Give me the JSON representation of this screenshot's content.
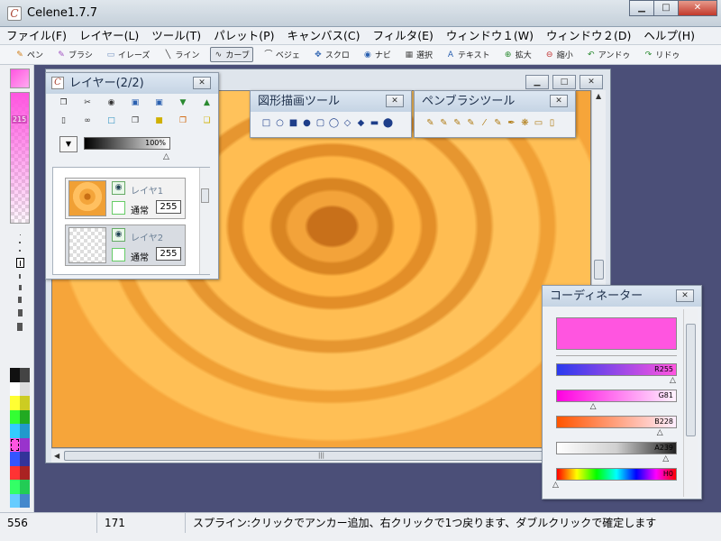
{
  "app": {
    "title": "Celene1.7.7",
    "icon": "C"
  },
  "window_buttons": {
    "minimize": "▁",
    "maximize": "□",
    "close": "✕"
  },
  "menu": [
    "ファイル(F)",
    "レイヤー(L)",
    "ツール(T)",
    "パレット(P)",
    "キャンバス(C)",
    "フィルタ(E)",
    "ウィンドウ１(W)",
    "ウィンドウ２(D)",
    "ヘルプ(H)"
  ],
  "toolbar": [
    {
      "label": "ペン",
      "icon": "pen-icon",
      "glyph": "✎",
      "color": "#d07a10",
      "active": false
    },
    {
      "label": "ブラシ",
      "icon": "brush-icon",
      "glyph": "✎",
      "color": "#a050c0",
      "active": false
    },
    {
      "label": "イレーズ",
      "icon": "eraser-icon",
      "glyph": "▭",
      "color": "#7090c0",
      "active": false
    },
    {
      "label": "ライン",
      "icon": "line-icon",
      "glyph": "╲",
      "color": "#333333",
      "active": false
    },
    {
      "label": "カーブ",
      "icon": "curve-icon",
      "glyph": "∿",
      "color": "#333333",
      "active": true
    },
    {
      "label": "ベジェ",
      "icon": "bezier-icon",
      "glyph": "⌒",
      "color": "#333333",
      "active": false
    },
    {
      "label": "スクロ",
      "icon": "scroll-icon",
      "glyph": "✥",
      "color": "#2a60b0",
      "active": false
    },
    {
      "label": "ナビ",
      "icon": "navi-icon",
      "glyph": "◉",
      "color": "#2a60b0",
      "active": false
    },
    {
      "label": "選択",
      "icon": "select-icon",
      "glyph": "▦",
      "color": "#555555",
      "active": false
    },
    {
      "label": "テキスト",
      "icon": "text-icon",
      "glyph": "A",
      "color": "#2a60b0",
      "active": false
    },
    {
      "label": "拡大",
      "icon": "zoom-in-icon",
      "glyph": "⊕",
      "color": "#2a8a30",
      "active": false
    },
    {
      "label": "縮小",
      "icon": "zoom-out-icon",
      "glyph": "⊖",
      "color": "#c03030",
      "active": false
    },
    {
      "label": "アンドゥ",
      "icon": "undo-icon",
      "glyph": "↶",
      "color": "#2a8a30",
      "active": false
    },
    {
      "label": "リドゥ",
      "icon": "redo-icon",
      "glyph": "↷",
      "color": "#2a8a30",
      "active": false
    }
  ],
  "left_panel": {
    "alpha_value": "215",
    "current_color": "#ff55e0",
    "palette": [
      "#111111",
      "#444444",
      "#ffffff",
      "#dddddd",
      "#ffff33",
      "#cccc22",
      "#33ff33",
      "#22aa22",
      "#33ccff",
      "#2299cc",
      "#ff55e0",
      "#9933cc",
      "#3355ff",
      "#333399",
      "#ff3333",
      "#aa2222",
      "#33ff66",
      "#22cc55",
      "#66ccff",
      "#4488cc"
    ]
  },
  "layer_palette": {
    "title": "レイヤー(2/2)",
    "opacity_label": "100%",
    "layers": [
      {
        "name": "レイヤ1",
        "mode": "通常",
        "opacity": "255",
        "selected": false
      },
      {
        "name": "レイヤ2",
        "mode": "通常",
        "opacity": "255",
        "selected": true
      }
    ]
  },
  "shape_palette": {
    "title": "図形描画ツール",
    "icons": [
      "□",
      "○",
      "■",
      "●",
      "▢",
      "◯",
      "◇",
      "◆",
      "▬",
      "⬤"
    ]
  },
  "pen_palette": {
    "title": "ペンブラシツール",
    "icons": [
      "✎",
      "✎",
      "✎",
      "✎",
      "⁄",
      "✎",
      "✒",
      "❋",
      "▭",
      "▯"
    ]
  },
  "coordinator": {
    "title": "コーディネーター",
    "color": "#ff55e0",
    "sliders": [
      {
        "label": "R255",
        "gradient": "linear-gradient(90deg,#2a3aee,#ff55e0)",
        "value": 1.0
      },
      {
        "label": "G81",
        "gradient": "linear-gradient(90deg,#ff00e0,#fff3ff)",
        "value": 0.32
      },
      {
        "label": "B228",
        "gradient": "linear-gradient(90deg,#ff5500,#ffeeff)",
        "value": 0.89
      },
      {
        "label": "A239",
        "gradient": "linear-gradient(90deg,#ffffff,#d0d0d0,#222222)",
        "value": 0.94
      },
      {
        "label": "H0",
        "gradient": "linear-gradient(90deg,#ff0000,#ffff00,#00ff00,#00ffff,#0000ff,#ff00ff,#ff0000)",
        "value": 0.0
      }
    ]
  },
  "status": {
    "x": "556",
    "y": "171",
    "message": "スプライン:クリックでアンカー追加、右クリックで1つ戻ります、ダブルクリックで確定します"
  }
}
